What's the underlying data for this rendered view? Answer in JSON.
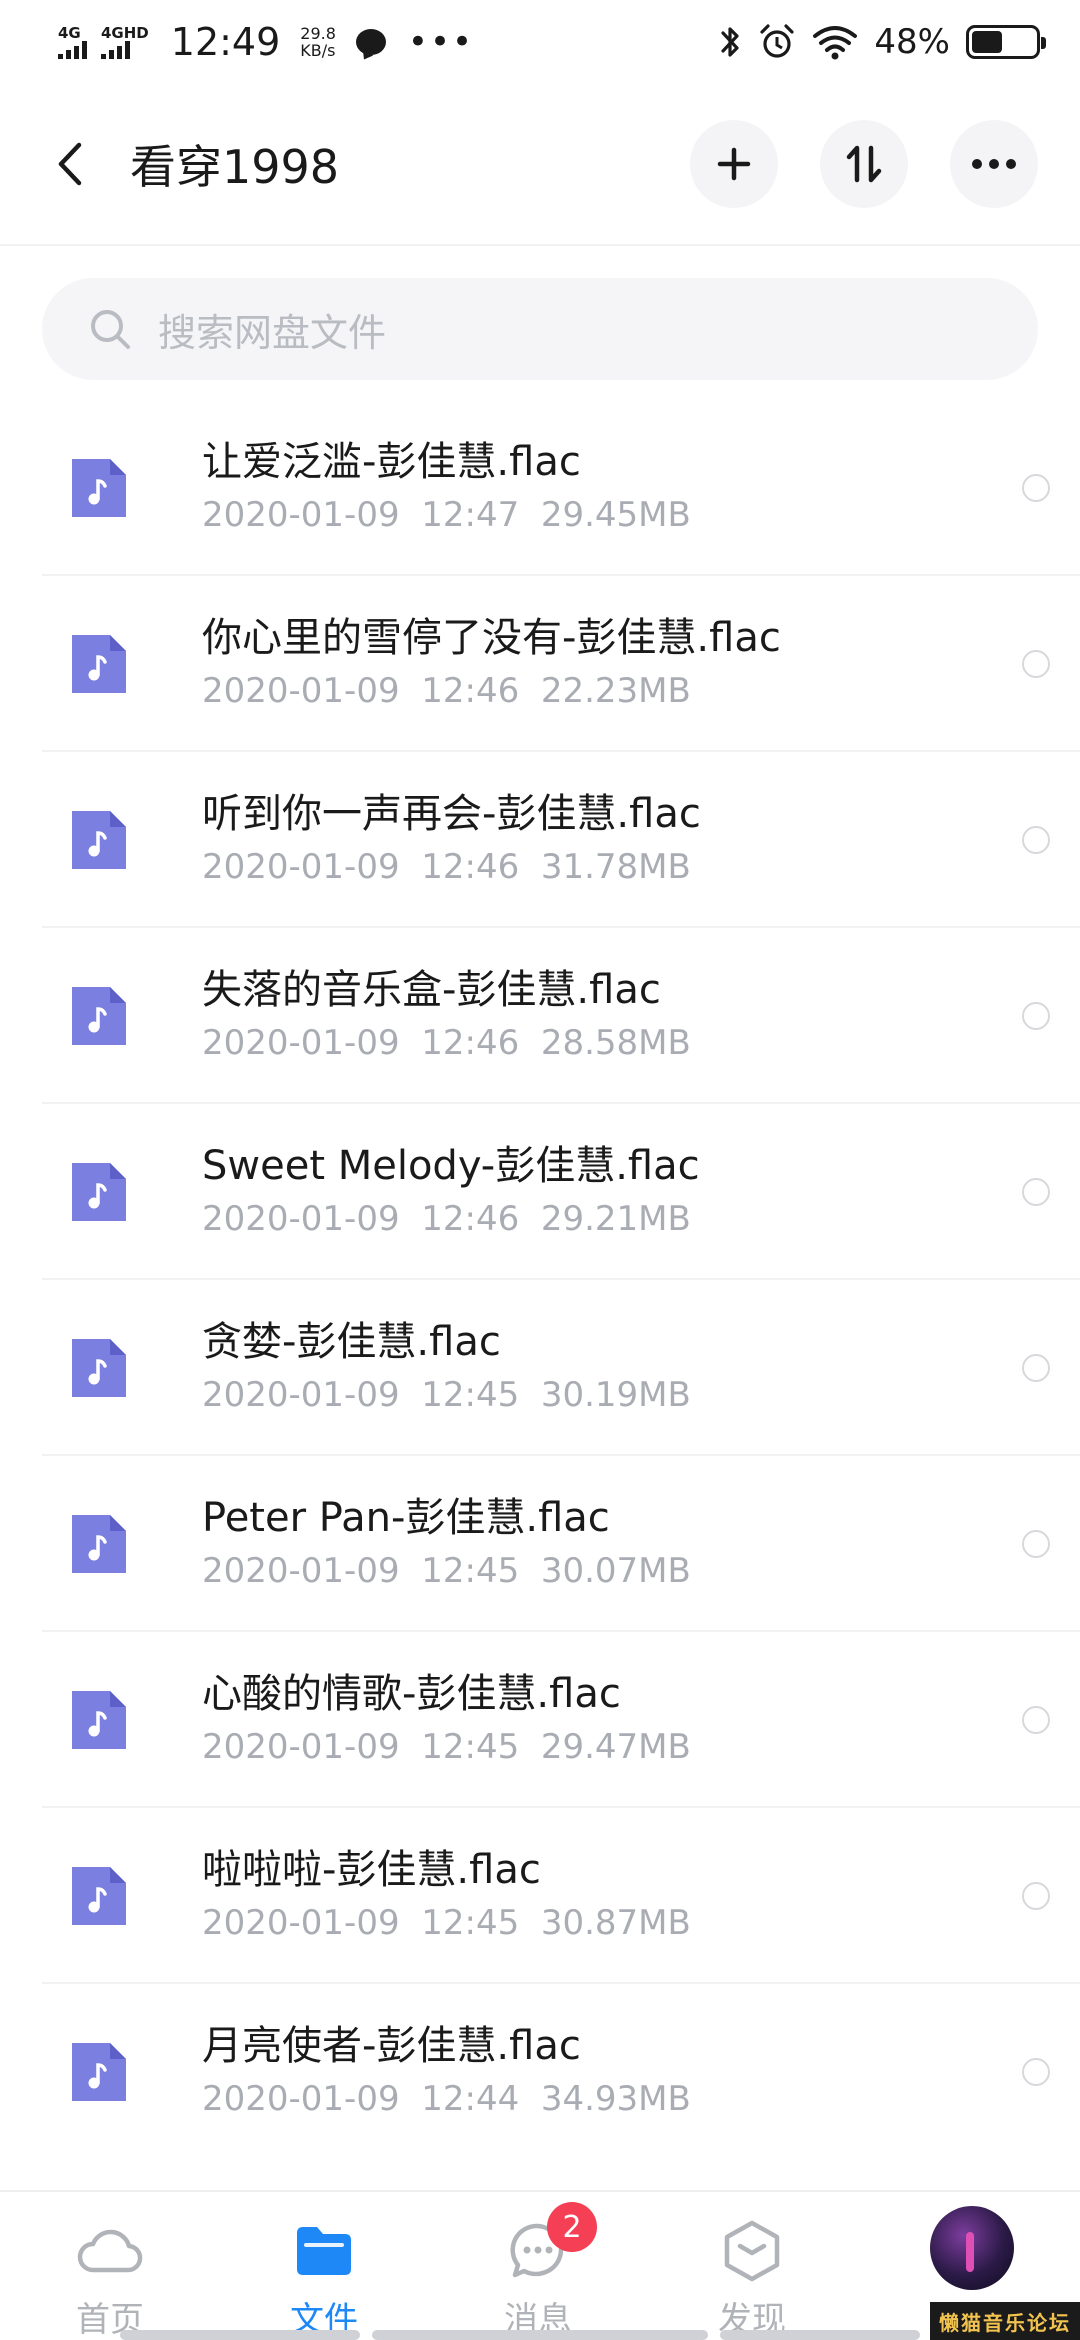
{
  "status_bar": {
    "signal1": "4G",
    "signal2": "4GHD",
    "time": "12:49",
    "speed_value": "29.8",
    "speed_unit": "KB/s",
    "more": "•••",
    "battery_percent": "48%",
    "battery_level": 0.48
  },
  "header": {
    "title": "看穿1998",
    "back_icon": "chevron-left-icon",
    "add_icon": "plus-icon",
    "sort_icon": "sort-icon",
    "more_icon": "more-horizontal-icon"
  },
  "search": {
    "placeholder": "搜索网盘文件"
  },
  "files": [
    {
      "name": "让爱泛滥-彭佳慧.flac",
      "date": "2020-01-09",
      "time": "12:47",
      "size": "29.45MB"
    },
    {
      "name": "你心里的雪停了没有-彭佳慧.flac",
      "date": "2020-01-09",
      "time": "12:46",
      "size": "22.23MB"
    },
    {
      "name": "听到你一声再会-彭佳慧.flac",
      "date": "2020-01-09",
      "time": "12:46",
      "size": "31.78MB"
    },
    {
      "name": "失落的音乐盒-彭佳慧.flac",
      "date": "2020-01-09",
      "time": "12:46",
      "size": "28.58MB"
    },
    {
      "name": "Sweet Melody-彭佳慧.flac",
      "date": "2020-01-09",
      "time": "12:46",
      "size": "29.21MB"
    },
    {
      "name": "贪婪-彭佳慧.flac",
      "date": "2020-01-09",
      "time": "12:45",
      "size": "30.19MB"
    },
    {
      "name": "Peter Pan-彭佳慧.flac",
      "date": "2020-01-09",
      "time": "12:45",
      "size": "30.07MB"
    },
    {
      "name": "心酸的情歌-彭佳慧.flac",
      "date": "2020-01-09",
      "time": "12:45",
      "size": "29.47MB"
    },
    {
      "name": "啦啦啦-彭佳慧.flac",
      "date": "2020-01-09",
      "time": "12:45",
      "size": "30.87MB"
    },
    {
      "name": "月亮使者-彭佳慧.flac",
      "date": "2020-01-09",
      "time": "12:44",
      "size": "34.93MB"
    }
  ],
  "bottom_nav": {
    "items": [
      {
        "label": "首页",
        "icon": "cloud-icon"
      },
      {
        "label": "文件",
        "icon": "folder-icon"
      },
      {
        "label": "消息",
        "icon": "chat-icon",
        "badge": "2"
      },
      {
        "label": "发现",
        "icon": "discover-cube-icon"
      }
    ],
    "active_index": 1
  },
  "watermark": "懒猫音乐论坛",
  "colors": {
    "accent": "#1e88f6",
    "file_icon": "#7b7fe0",
    "badge": "#f43f55",
    "meta_text": "#a9adb3"
  }
}
